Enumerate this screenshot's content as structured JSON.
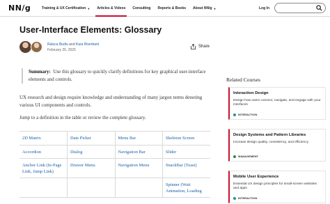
{
  "header": {
    "logo": "NN/g",
    "nav": [
      {
        "label": "Training & UX Certification",
        "caret": true,
        "active": false
      },
      {
        "label": "Articles & Videos",
        "caret": false,
        "active": true
      },
      {
        "label": "Consulting",
        "caret": false,
        "active": false
      },
      {
        "label": "Reports & Books",
        "caret": false,
        "active": false
      },
      {
        "label": "About NN/g",
        "caret": true,
        "active": false
      }
    ],
    "login": "Log In",
    "search_placeholder": ""
  },
  "article": {
    "title": "User-Interface Elements: Glossary",
    "author_1": "Raluca Budiu",
    "and": "and",
    "author_2": "Kara Riverbark",
    "date": "February 26, 2025",
    "share": "Share",
    "summary_label": "Summary:",
    "summary_text": "Use this glossary to quickly clarify definitions for key graphical user-interface elements and controls.",
    "para_1": "UX research and design require knowledge and understanding of many jargon terms denoting various UI components and controls.",
    "para_2": "Jump to a definition in the table or review the complete glossary."
  },
  "glossary": [
    [
      "2D Matrix",
      "Date Picker",
      "Menu Bar",
      "Skeleton Screen"
    ],
    [
      "Accordion",
      "Dialog",
      "Navigation Bar",
      "Slider"
    ],
    [
      "Anchor Link (In-Page Link, Jump Link)",
      "Drawer Menu",
      "Navigation Menu",
      "SnackBar (Toast)"
    ],
    [
      "",
      "",
      "",
      "Spinner (Wait Animation, Loading"
    ]
  ],
  "sidebar": {
    "heading": "Related Courses",
    "courses": [
      {
        "title": "Interaction Design",
        "desc": "Design how users connect, navigate, and engage with your interfaces",
        "tag": "INTERACTION",
        "tag_color": "#1f9a8a"
      },
      {
        "title": "Design Systems and Pattern Libraries",
        "desc": "Increase design quality, consistency, and efficiency",
        "tag": "MANAGEMENT",
        "tag_color": "#2e8b3a"
      },
      {
        "title": "Mobile User Experience",
        "desc": "Essential UX design principles for small-screen websites and apps",
        "tag": "INTERACTION",
        "tag_color": "#1f9a8a"
      }
    ]
  },
  "colors": {
    "accent": "#c8102e",
    "link": "#1a5ea8"
  }
}
